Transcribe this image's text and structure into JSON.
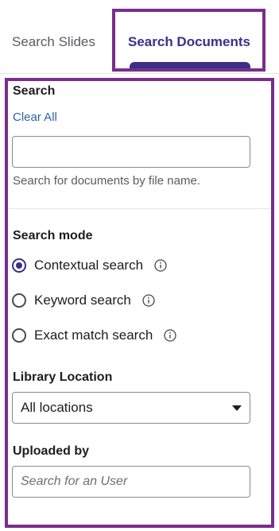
{
  "tabs": {
    "slides_label": "Search Slides",
    "documents_label": "Search Documents",
    "active": "Search Documents"
  },
  "search": {
    "title": "Search",
    "clear_all": "Clear All",
    "value": "",
    "helper": "Search for documents by file name."
  },
  "search_mode": {
    "title": "Search mode",
    "options": [
      {
        "label": "Contextual search",
        "checked": true,
        "icon": "info-icon"
      },
      {
        "label": "Keyword search",
        "checked": false,
        "icon": "info-icon"
      },
      {
        "label": "Exact match search",
        "checked": false,
        "icon": "info-icon"
      }
    ]
  },
  "library_location": {
    "title": "Library Location",
    "selected": "All locations"
  },
  "uploaded_by": {
    "title": "Uploaded by",
    "placeholder": "Search for an User",
    "value": ""
  },
  "colors": {
    "accent": "#3b2f8a",
    "highlight_frame": "#7a2d8c",
    "link": "#2b63a6"
  }
}
